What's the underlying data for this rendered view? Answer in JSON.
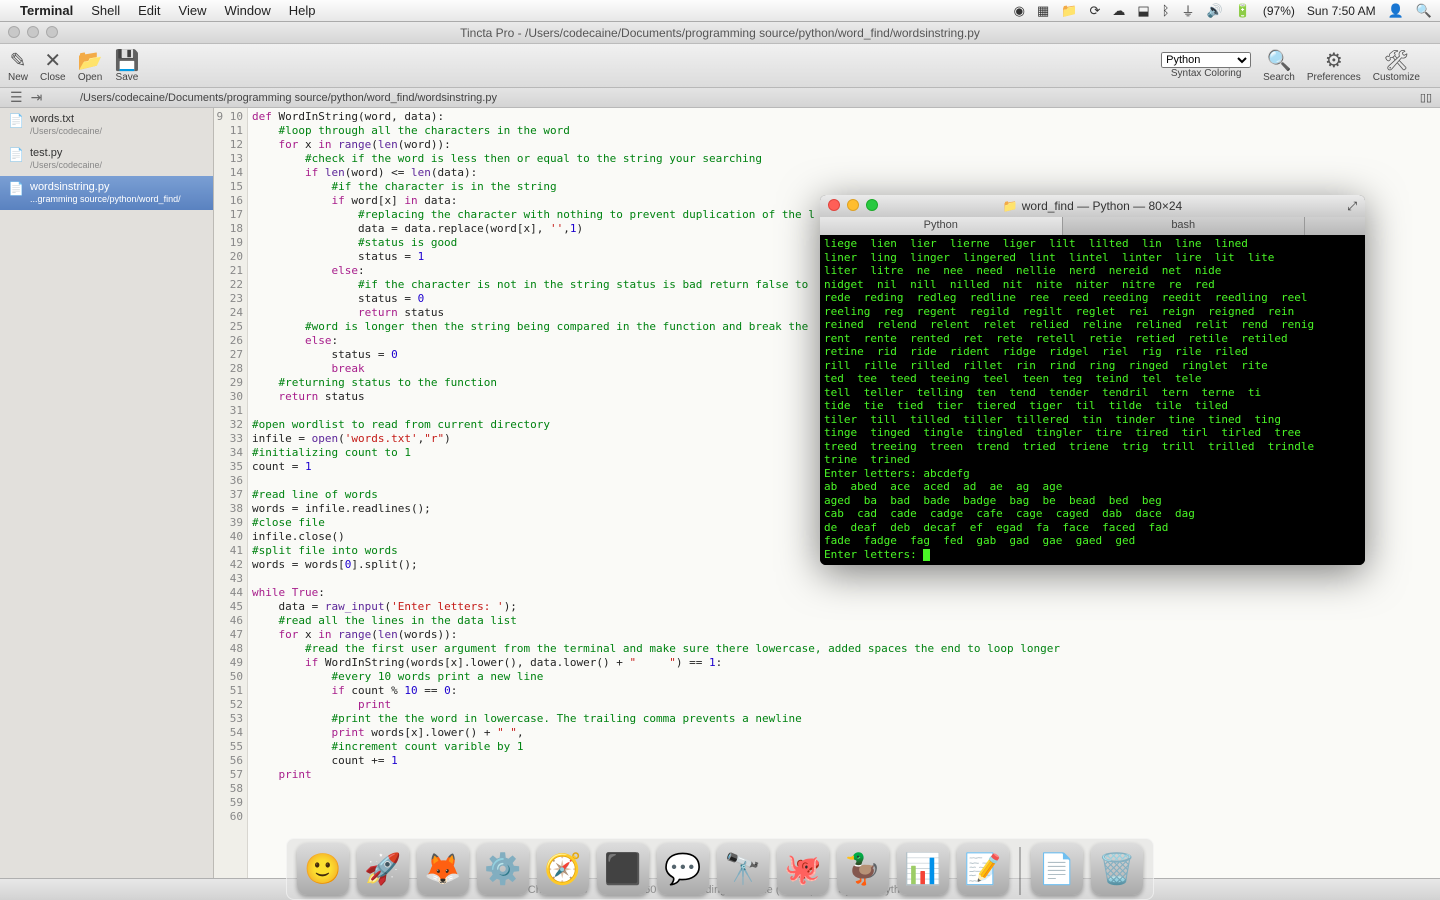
{
  "menubar": {
    "app": "Terminal",
    "items": [
      "Shell",
      "Edit",
      "View",
      "Window",
      "Help"
    ],
    "battery": "(97%)",
    "clock": "Sun 7:50 AM"
  },
  "editor": {
    "windowTitle": "Tincta Pro - /Users/codecaine/Documents/programming source/python/word_find/wordsinstring.py",
    "toolbar": {
      "new": "New",
      "close": "Close",
      "open": "Open",
      "save": "Save",
      "syntax_label": "Syntax Coloring",
      "syntax_value": "Python",
      "search": "Search",
      "prefs": "Preferences",
      "customize": "Customize"
    },
    "pathbar": "/Users/codecaine/Documents/programming source/python/word_find/wordsinstring.py",
    "files": [
      {
        "name": "words.txt",
        "path": "/Users/codecaine/",
        "active": false
      },
      {
        "name": "test.py",
        "path": "/Users/codecaine/",
        "active": false
      },
      {
        "name": "wordsinstring.py",
        "path": "...gramming source/python/word_find/",
        "active": true
      }
    ],
    "line_start": 9,
    "line_end": 60,
    "code_lines": [
      {
        "tokens": [
          [
            "kw",
            "def"
          ],
          [
            "",
            " WordInString(word, data):"
          ]
        ]
      },
      {
        "tokens": [
          [
            "",
            "    "
          ],
          [
            "com",
            "#loop through all the characters in the word"
          ]
        ]
      },
      {
        "tokens": [
          [
            "",
            "    "
          ],
          [
            "kw",
            "for"
          ],
          [
            "",
            " x "
          ],
          [
            "kw",
            "in"
          ],
          [
            "",
            " "
          ],
          [
            "fn",
            "range"
          ],
          [
            "",
            "("
          ],
          [
            "fn",
            "len"
          ],
          [
            "",
            "(word)):"
          ]
        ]
      },
      {
        "tokens": [
          [
            "",
            "        "
          ],
          [
            "com",
            "#check if the word is less then or equal to the string your searching"
          ]
        ]
      },
      {
        "tokens": [
          [
            "",
            "        "
          ],
          [
            "kw",
            "if"
          ],
          [
            "",
            " "
          ],
          [
            "fn",
            "len"
          ],
          [
            "",
            "(word) <= "
          ],
          [
            "fn",
            "len"
          ],
          [
            "",
            "(data):"
          ]
        ]
      },
      {
        "tokens": [
          [
            "",
            "            "
          ],
          [
            "com",
            "#if the character is in the string"
          ]
        ]
      },
      {
        "tokens": [
          [
            "",
            "            "
          ],
          [
            "kw",
            "if"
          ],
          [
            "",
            " word[x] "
          ],
          [
            "kw",
            "in"
          ],
          [
            "",
            " data:"
          ]
        ]
      },
      {
        "tokens": [
          [
            "",
            "                "
          ],
          [
            "com",
            "#replacing the character with nothing to prevent duplication of the l"
          ]
        ]
      },
      {
        "tokens": [
          [
            "",
            "                data = data.replace(word[x], "
          ],
          [
            "str",
            "''"
          ],
          [
            "",
            ","
          ],
          [
            "num",
            "1"
          ],
          [
            "",
            ")"
          ]
        ]
      },
      {
        "tokens": [
          [
            "",
            "                "
          ],
          [
            "com",
            "#status is good"
          ]
        ]
      },
      {
        "tokens": [
          [
            "",
            "                status = "
          ],
          [
            "num",
            "1"
          ]
        ]
      },
      {
        "tokens": [
          [
            "",
            "            "
          ],
          [
            "kw",
            "else"
          ],
          [
            "",
            ":"
          ]
        ]
      },
      {
        "tokens": [
          [
            "",
            "                "
          ],
          [
            "com",
            "#if the character is not in the string status is bad return false to "
          ]
        ]
      },
      {
        "tokens": [
          [
            "",
            "                status = "
          ],
          [
            "num",
            "0"
          ]
        ]
      },
      {
        "tokens": [
          [
            "",
            "                "
          ],
          [
            "kw",
            "return"
          ],
          [
            "",
            " status"
          ]
        ]
      },
      {
        "tokens": [
          [
            "",
            "        "
          ],
          [
            "com",
            "#word is longer then the string being compared in the function and break the"
          ]
        ]
      },
      {
        "tokens": [
          [
            "",
            "        "
          ],
          [
            "kw",
            "else"
          ],
          [
            "",
            ":"
          ]
        ]
      },
      {
        "tokens": [
          [
            "",
            "            status = "
          ],
          [
            "num",
            "0"
          ]
        ]
      },
      {
        "tokens": [
          [
            "",
            "            "
          ],
          [
            "kw",
            "break"
          ]
        ]
      },
      {
        "tokens": [
          [
            "",
            "    "
          ],
          [
            "com",
            "#returning status to the function"
          ]
        ]
      },
      {
        "tokens": [
          [
            "",
            "    "
          ],
          [
            "kw",
            "return"
          ],
          [
            "",
            " status"
          ]
        ]
      },
      {
        "tokens": [
          [
            "",
            ""
          ]
        ]
      },
      {
        "tokens": [
          [
            "com",
            "#open wordlist to read from current directory"
          ]
        ]
      },
      {
        "tokens": [
          [
            "",
            "infile = "
          ],
          [
            "fn",
            "open"
          ],
          [
            "",
            "("
          ],
          [
            "str",
            "'words.txt'"
          ],
          [
            "",
            ","
          ],
          [
            "str",
            "\"r\""
          ],
          [
            "",
            ")"
          ]
        ]
      },
      {
        "tokens": [
          [
            "com",
            "#initializing count to 1"
          ]
        ]
      },
      {
        "tokens": [
          [
            "",
            "count = "
          ],
          [
            "num",
            "1"
          ]
        ]
      },
      {
        "tokens": [
          [
            "",
            ""
          ]
        ]
      },
      {
        "tokens": [
          [
            "com",
            "#read line of words"
          ]
        ]
      },
      {
        "tokens": [
          [
            "",
            "words = infile.readlines();"
          ]
        ]
      },
      {
        "tokens": [
          [
            "com",
            "#close file"
          ]
        ]
      },
      {
        "tokens": [
          [
            "",
            "infile.close()"
          ]
        ]
      },
      {
        "tokens": [
          [
            "com",
            "#split file into words"
          ]
        ]
      },
      {
        "tokens": [
          [
            "",
            "words = words["
          ],
          [
            "num",
            "0"
          ],
          [
            "",
            "].split();"
          ]
        ]
      },
      {
        "tokens": [
          [
            "",
            ""
          ]
        ]
      },
      {
        "tokens": [
          [
            "kw",
            "while"
          ],
          [
            "",
            " "
          ],
          [
            "kw",
            "True"
          ],
          [
            "",
            ":"
          ]
        ]
      },
      {
        "tokens": [
          [
            "",
            "    data = "
          ],
          [
            "fn",
            "raw_input"
          ],
          [
            "",
            "("
          ],
          [
            "str",
            "'Enter letters: '"
          ],
          [
            "",
            ");"
          ]
        ]
      },
      {
        "tokens": [
          [
            "",
            "    "
          ],
          [
            "com",
            "#read all the lines in the data list"
          ]
        ]
      },
      {
        "tokens": [
          [
            "",
            "    "
          ],
          [
            "kw",
            "for"
          ],
          [
            "",
            " x "
          ],
          [
            "kw",
            "in"
          ],
          [
            "",
            " "
          ],
          [
            "fn",
            "range"
          ],
          [
            "",
            "("
          ],
          [
            "fn",
            "len"
          ],
          [
            "",
            "(words)):"
          ]
        ]
      },
      {
        "tokens": [
          [
            "",
            "        "
          ],
          [
            "com",
            "#read the first user argument from the terminal and make sure there lowercase, added spaces the end to loop longer"
          ]
        ]
      },
      {
        "tokens": [
          [
            "",
            "        "
          ],
          [
            "kw",
            "if"
          ],
          [
            "",
            " WordInString(words[x].lower(), data.lower() + "
          ],
          [
            "str",
            "\"     \""
          ],
          [
            "",
            ") == "
          ],
          [
            "num",
            "1"
          ],
          [
            "",
            ":"
          ]
        ]
      },
      {
        "tokens": [
          [
            "",
            "            "
          ],
          [
            "com",
            "#every 10 words print a new line"
          ]
        ]
      },
      {
        "tokens": [
          [
            "",
            "            "
          ],
          [
            "kw",
            "if"
          ],
          [
            "",
            " count % "
          ],
          [
            "num",
            "10"
          ],
          [
            "",
            " == "
          ],
          [
            "num",
            "0"
          ],
          [
            "",
            ":"
          ]
        ]
      },
      {
        "tokens": [
          [
            "",
            "                "
          ],
          [
            "kw",
            "print"
          ]
        ]
      },
      {
        "tokens": [
          [
            "",
            "            "
          ],
          [
            "com",
            "#print the the word in lowercase. The trailing comma prevents a newline"
          ]
        ]
      },
      {
        "tokens": [
          [
            "",
            "            "
          ],
          [
            "kw",
            "print"
          ],
          [
            "",
            " words[x].lower() + "
          ],
          [
            "str",
            "\" \""
          ],
          [
            "",
            ","
          ]
        ]
      },
      {
        "tokens": [
          [
            "",
            "            "
          ],
          [
            "com",
            "#increment count varible by 1"
          ]
        ]
      },
      {
        "tokens": [
          [
            "",
            "            count += "
          ],
          [
            "num",
            "1"
          ]
        ]
      },
      {
        "tokens": [
          [
            "",
            "    "
          ],
          [
            "kw",
            "print"
          ]
        ]
      },
      {
        "tokens": [
          [
            "",
            ""
          ]
        ]
      },
      {
        "tokens": [
          [
            "",
            ""
          ]
        ]
      },
      {
        "tokens": [
          [
            "",
            ""
          ]
        ]
      },
      {
        "tokens": [
          [
            "",
            ""
          ]
        ]
      }
    ],
    "status": {
      "chars": "Chars: 1706",
      "lines": "Lines: 60",
      "encoding": "Encoding: Unicode (UTF-8)",
      "syntax": "Syntax: Python"
    }
  },
  "terminal": {
    "title": "word_find — Python — 80×24",
    "tabs": [
      "Python",
      "bash"
    ],
    "active_tab": 0,
    "output": "liege  lien  lier  lierne  liger  lilt  lilted  lin  line  lined\nliner  ling  linger  lingered  lint  lintel  linter  lire  lit  lite\nliter  litre  ne  nee  need  nellie  nerd  nereid  net  nide\nnidget  nil  nill  nilled  nit  nite  niter  nitre  re  red\nrede  reding  redleg  redline  ree  reed  reeding  reedit  reedling  reel\nreeling  reg  regent  regild  regilt  reglet  rei  reign  reigned  rein\nreined  relend  relent  relet  relied  reline  relined  relit  rend  renig\nrent  rente  rented  ret  rete  retell  retie  retied  retile  retiled\nretine  rid  ride  rident  ridge  ridgel  riel  rig  rile  riled\nrill  rille  rilled  rillet  rin  rind  ring  ringed  ringlet  rite\nted  tee  teed  teeing  teel  teen  teg  teind  tel  tele\ntell  teller  telling  ten  tend  tender  tendril  tern  terne  ti\ntide  tie  tied  tier  tiered  tiger  til  tilde  tile  tiled\ntiler  till  tilled  tiller  tillered  tin  tinder  tine  tined  ting\ntinge  tinged  tingle  tingled  tingler  tire  tired  tirl  tirled  tree\ntreed  treeing  treen  trend  tried  triene  trig  trill  trilled  trindle\ntrine  trined\nEnter letters: abcdefg\nab  abed  ace  aced  ad  ae  ag  age\naged  ba  bad  bade  badge  bag  be  bead  bed  beg\ncab  cad  cade  cadge  cafe  cage  caged  dab  dace  dag\nde  deaf  deb  decaf  ef  egad  fa  face  faced  fad\nfade  fadge  fag  fed  gab  gad  gae  gaed  ged\nEnter letters: "
  },
  "dock": {
    "apps": [
      "finder",
      "launchpad",
      "firefox",
      "settings",
      "safari-like",
      "terminal",
      "messages",
      "binoculars",
      "octopus",
      "adium",
      "activity",
      "textedit"
    ],
    "extras": [
      "document",
      "trash"
    ]
  }
}
